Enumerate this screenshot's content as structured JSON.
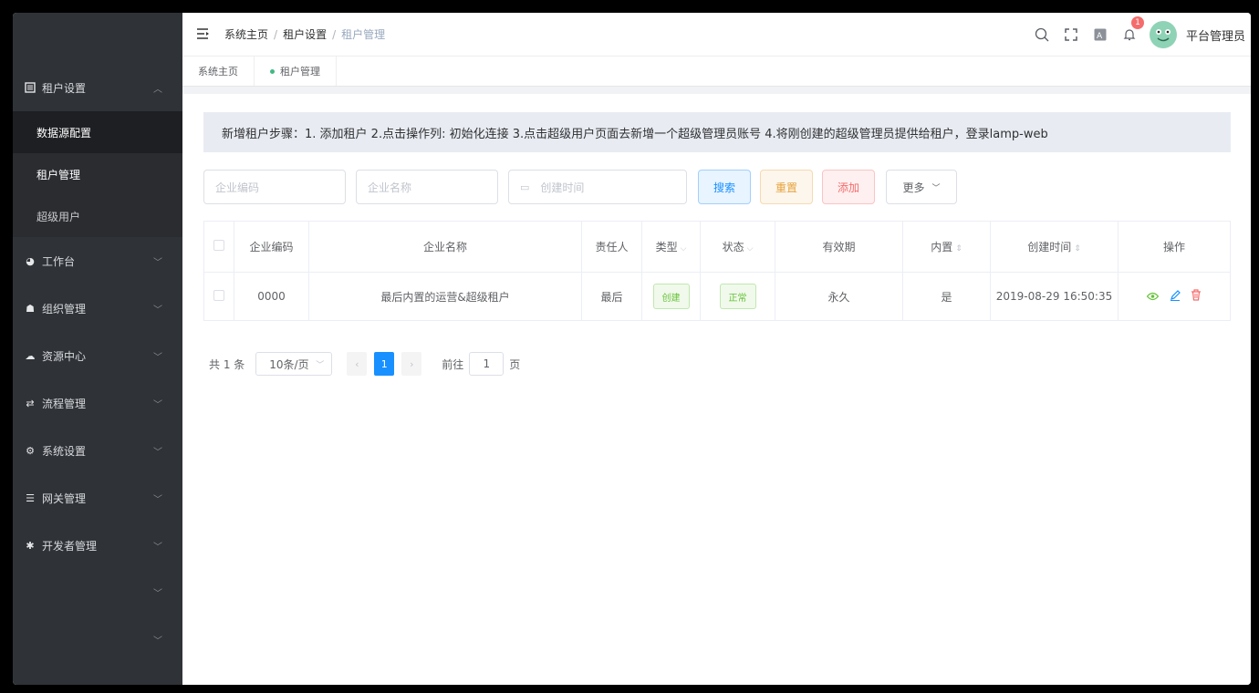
{
  "sidebar": {
    "groups": [
      {
        "label": "租户设置",
        "icon": "tenant-icon",
        "expanded": true,
        "children": [
          "数据源配置",
          "租户管理",
          "超级用户"
        ]
      },
      {
        "label": "工作台",
        "icon": "dashboard-icon"
      },
      {
        "label": "组织管理",
        "icon": "organization-icon"
      },
      {
        "label": "资源中心",
        "icon": "cloud-icon"
      },
      {
        "label": "流程管理",
        "icon": "workflow-icon"
      },
      {
        "label": "系统设置",
        "icon": "settings-icon"
      },
      {
        "label": "网关管理",
        "icon": "gateway-icon"
      },
      {
        "label": "开发者管理",
        "icon": "bug-icon"
      }
    ]
  },
  "header": {
    "breadcrumb": [
      "系统主页",
      "租户设置",
      "租户管理"
    ],
    "notification_count": "1",
    "username": "平台管理员"
  },
  "tags": [
    "系统主页",
    "租户管理"
  ],
  "notice": "新增租户步骤：1. 添加租户 2.点击操作列: 初始化连接 3.点击超级用户页面去新增一个超级管理员账号 4.将刚创建的超级管理员提供给租户，登录lamp-web",
  "filters": {
    "code_placeholder": "企业编码",
    "name_placeholder": "企业名称",
    "date_placeholder": "创建时间",
    "search": "搜索",
    "reset": "重置",
    "add": "添加",
    "more": "更多"
  },
  "table": {
    "columns": [
      "企业编码",
      "企业名称",
      "责任人",
      "类型",
      "状态",
      "有效期",
      "内置",
      "创建时间",
      "操作"
    ],
    "rows": [
      {
        "code": "0000",
        "name": "最后内置的运营&超级租户",
        "owner": "最后",
        "type": "创建",
        "status": "正常",
        "validity": "永久",
        "builtin": "是",
        "created": "2019-08-29 16:50:35"
      }
    ]
  },
  "pagination": {
    "total": "共 1 条",
    "page_size": "10条/页",
    "current_page": "1",
    "goto_label": "前往",
    "goto_value": "1",
    "page_unit": "页"
  },
  "colors": {
    "sidebar_bg": "#2f3237",
    "primary": "#1890ff",
    "success": "#67c23a",
    "warning": "#e6a23c",
    "danger": "#f56c6c"
  }
}
